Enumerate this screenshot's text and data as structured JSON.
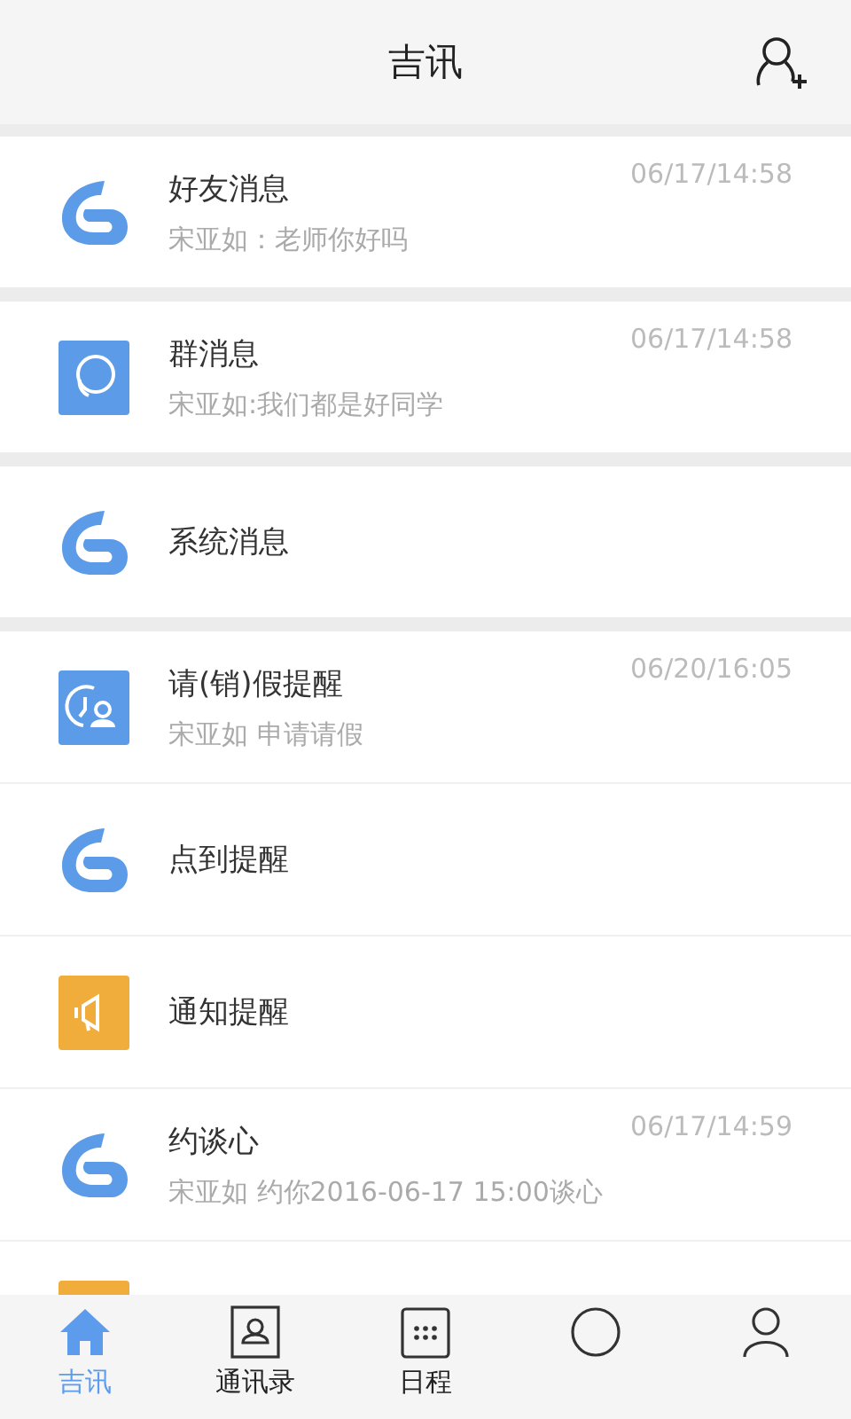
{
  "header": {
    "title": "吉讯"
  },
  "sections": [
    {
      "items": [
        {
          "kind": "logo",
          "title": "好友消息",
          "subtitle": "宋亚如：老师你好吗",
          "time": "06/17/14:58"
        }
      ]
    },
    {
      "items": [
        {
          "kind": "group",
          "title": "群消息",
          "subtitle": "宋亚如:我们都是好同学",
          "time": "06/17/14:58"
        }
      ]
    },
    {
      "items": [
        {
          "kind": "logo",
          "title": "系统消息"
        }
      ]
    },
    {
      "items": [
        {
          "kind": "leave",
          "title": "请(销)假提醒",
          "subtitle": "宋亚如  申请请假",
          "time": "06/20/16:05"
        },
        {
          "kind": "logo",
          "title": "点到提醒"
        },
        {
          "kind": "notice",
          "title": "通知提醒"
        },
        {
          "kind": "logo",
          "title": "约谈心",
          "subtitle": "宋亚如  约你2016-06-17  15:00谈心",
          "time": "06/17/14:59"
        },
        {
          "kind": "notice"
        }
      ]
    }
  ],
  "tabs": [
    {
      "kind": "home",
      "label": "吉讯",
      "selected": true
    },
    {
      "kind": "contacts",
      "label": "通讯录",
      "selected": false
    },
    {
      "kind": "calendar",
      "label": "日程",
      "selected": false
    },
    {
      "kind": "circle",
      "selected": false
    },
    {
      "kind": "person",
      "selected": false
    }
  ]
}
